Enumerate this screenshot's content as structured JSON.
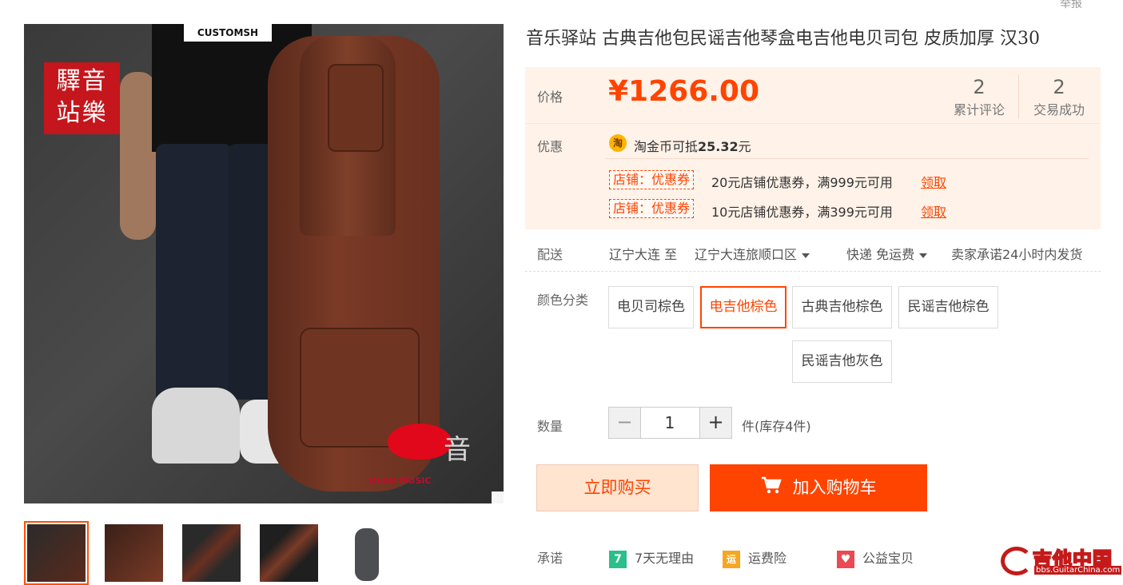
{
  "report_label": "举报",
  "product": {
    "title": "音乐驿站 古典吉他包民谣吉他琴盒电吉他电贝司包 皮质加厚 汉30",
    "shirt_text": "CUSTOMSH",
    "seal_text": "驛音站樂",
    "watermark_brand": "DEAR MUSIC",
    "watermark_char": "音"
  },
  "price_box": {
    "price_label": "价格",
    "price": "¥1266.00",
    "reviews_count": "2",
    "reviews_label": "累计评论",
    "deals_count": "2",
    "deals_label": "交易成功",
    "promo_label": "优惠",
    "coin_icon": "淘",
    "coin_text_prefix": "淘金币可抵",
    "coin_amount": "25.32",
    "coin_unit": "元",
    "coupons": [
      {
        "tag": "店铺：优惠券",
        "desc": "20元店铺优惠券，满999元可用",
        "link": "领取"
      },
      {
        "tag": "店铺：优惠券",
        "desc": "10元店铺优惠券，满399元可用",
        "link": "领取"
      }
    ]
  },
  "shipping": {
    "label": "配送",
    "from": "辽宁大连  至",
    "to": "辽宁大连旅顺口区",
    "method": "快递  免运费",
    "promise": "卖家承诺24小时内发货"
  },
  "color": {
    "label": "颜色分类",
    "options": [
      "电贝司棕色",
      "电吉他棕色",
      "古典吉他棕色",
      "民谣吉他棕色",
      "民谣吉他灰色"
    ],
    "selected": "电吉他棕色"
  },
  "quantity": {
    "label": "数量",
    "minus": "−",
    "value": "1",
    "plus": "+",
    "stock": "件(库存4件)"
  },
  "actions": {
    "buy_now": "立即购买",
    "add_cart": "加入购物车"
  },
  "promise": {
    "label": "承诺",
    "items": [
      {
        "icon": "7",
        "text": "7天无理由"
      },
      {
        "icon": "运",
        "text": "运费险"
      },
      {
        "icon": "♥",
        "text": "公益宝贝"
      }
    ]
  },
  "watermark": {
    "site_name": "吉他中国",
    "site_url": "bbs.GuitarChina.com"
  },
  "colors": {
    "accent": "#ff4400",
    "price_bg": "#fff2e8"
  }
}
